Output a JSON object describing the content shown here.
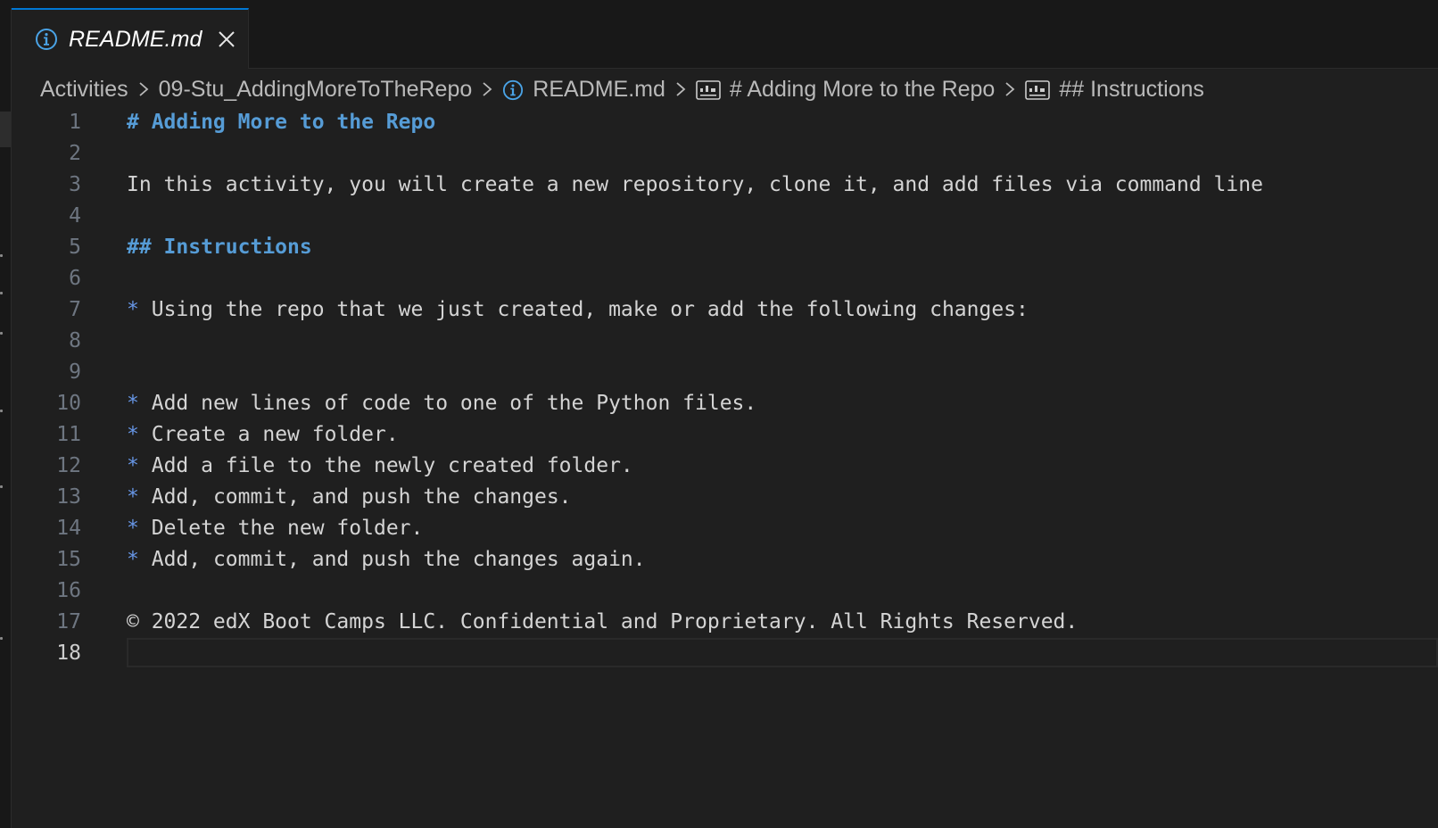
{
  "tab": {
    "label": "README.md",
    "icon": "info-icon",
    "accent_color": "#0078d4"
  },
  "breadcrumb": {
    "items": [
      "Activities",
      "09-Stu_AddingMoreToTheRepo",
      "README.md",
      "# Adding More to the Repo",
      "## Instructions"
    ]
  },
  "editor": {
    "current_line": 18,
    "lines": [
      {
        "n": "1",
        "text": "# Adding More to the Repo"
      },
      {
        "n": "2",
        "text": ""
      },
      {
        "n": "3",
        "text": "In this activity, you will create a new repository, clone it, and add files via command line"
      },
      {
        "n": "4",
        "text": ""
      },
      {
        "n": "5",
        "text": "## Instructions"
      },
      {
        "n": "6",
        "text": ""
      },
      {
        "n": "7",
        "bullet": "*",
        "text": "Using the repo that we just created, make or add the following changes:"
      },
      {
        "n": "8",
        "text": ""
      },
      {
        "n": "9",
        "text": ""
      },
      {
        "n": "10",
        "bullet": "*",
        "text": "Add new lines of code to one of the Python files."
      },
      {
        "n": "11",
        "bullet": "*",
        "text": "Create a new folder."
      },
      {
        "n": "12",
        "bullet": "*",
        "text": "Add a file to the newly created folder."
      },
      {
        "n": "13",
        "bullet": "*",
        "text": "Add, commit, and push the changes."
      },
      {
        "n": "14",
        "bullet": "*",
        "text": "Delete the new folder."
      },
      {
        "n": "15",
        "bullet": "*",
        "text": "Add, commit, and push the changes again."
      },
      {
        "n": "16",
        "text": ""
      },
      {
        "n": "17",
        "text": "© 2022 edX Boot Camps LLC. Confidential and Proprietary. All Rights Reserved."
      },
      {
        "n": "18",
        "text": ""
      }
    ]
  },
  "colors": {
    "heading": "#569cd6",
    "bullet": "#6796e6",
    "text": "#d4d4d4",
    "line_number": "#6e7681",
    "background": "#1f1f1f"
  }
}
